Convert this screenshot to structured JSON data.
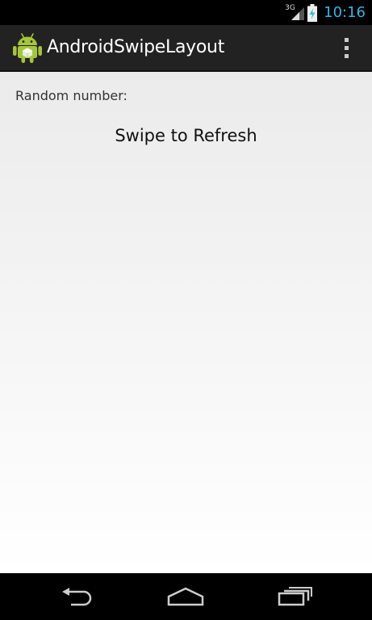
{
  "status_bar": {
    "network_type": "3G",
    "time": "10:16",
    "signal_icon": "signal-bars-icon",
    "battery_icon": "battery-charging-icon"
  },
  "action_bar": {
    "app_icon": "android-robot-icon",
    "title": "AndroidSwipeLayout",
    "overflow_icon": "overflow-menu-icon"
  },
  "content": {
    "random_number_label": "Random number:",
    "swipe_label": "Swipe to Refresh"
  },
  "nav_bar": {
    "back_icon": "back-icon",
    "home_icon": "home-icon",
    "recents_icon": "recent-apps-icon"
  },
  "colors": {
    "clock_accent": "#33b5e5",
    "action_bar_bg": "#222222",
    "content_gradient_top": "#ebebeb",
    "content_gradient_bottom": "#ffffff"
  }
}
